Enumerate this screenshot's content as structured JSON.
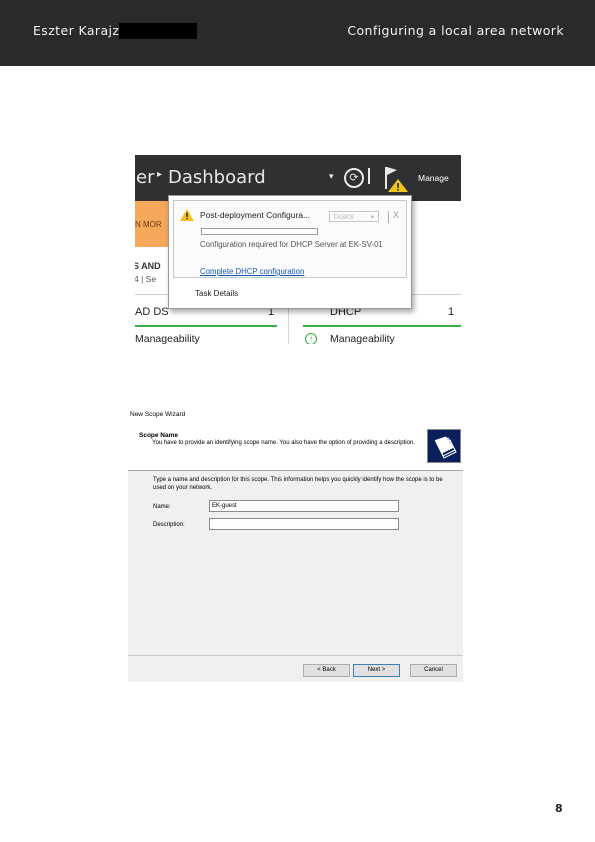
{
  "header": {
    "author": "Eszter Karajz",
    "title": "Configuring a local area network"
  },
  "server_manager": {
    "crumb_partial": "er",
    "crumb_separator": "▸",
    "dashboard": "Dashboard",
    "manage": "Manage",
    "banner_partial": "N MOR",
    "services_partial": "S AND",
    "sub_partial": "4  |  Se",
    "tile_left": "AD DS",
    "tile_left_count": "1",
    "tile_right": "DHCP",
    "tile_right_count": "1",
    "manageability_left": "Manageability",
    "manageability_right": "Manageability",
    "notification": {
      "title": "Post-deployment Configura...",
      "tasks": "TASKS",
      "close": "X",
      "progress": 0,
      "message": "Configuration required for DHCP Server at EK-SV-01",
      "link": "Complete DHCP configuration",
      "details": "Task Details"
    }
  },
  "wizard": {
    "window_title": "New Scope Wizard",
    "heading": "Scope Name",
    "description": "You have to provide an identifying scope name. You also have the option of providing a description.",
    "instructions": "Type a name and description for this scope. This information helps you quickly identify how the scope is to be used on your network.",
    "name_label": "Name:",
    "name_value": "EK-guest",
    "description_label": "Description:",
    "description_value": "",
    "back": "< Back",
    "next": "Next >",
    "cancel": "Cancel"
  },
  "page_number": "8",
  "colors": {
    "header_bg": "#2b2a29",
    "status_green": "#38b03f",
    "warning_yellow": "#f2c31b",
    "link_blue": "#1a58b8"
  }
}
